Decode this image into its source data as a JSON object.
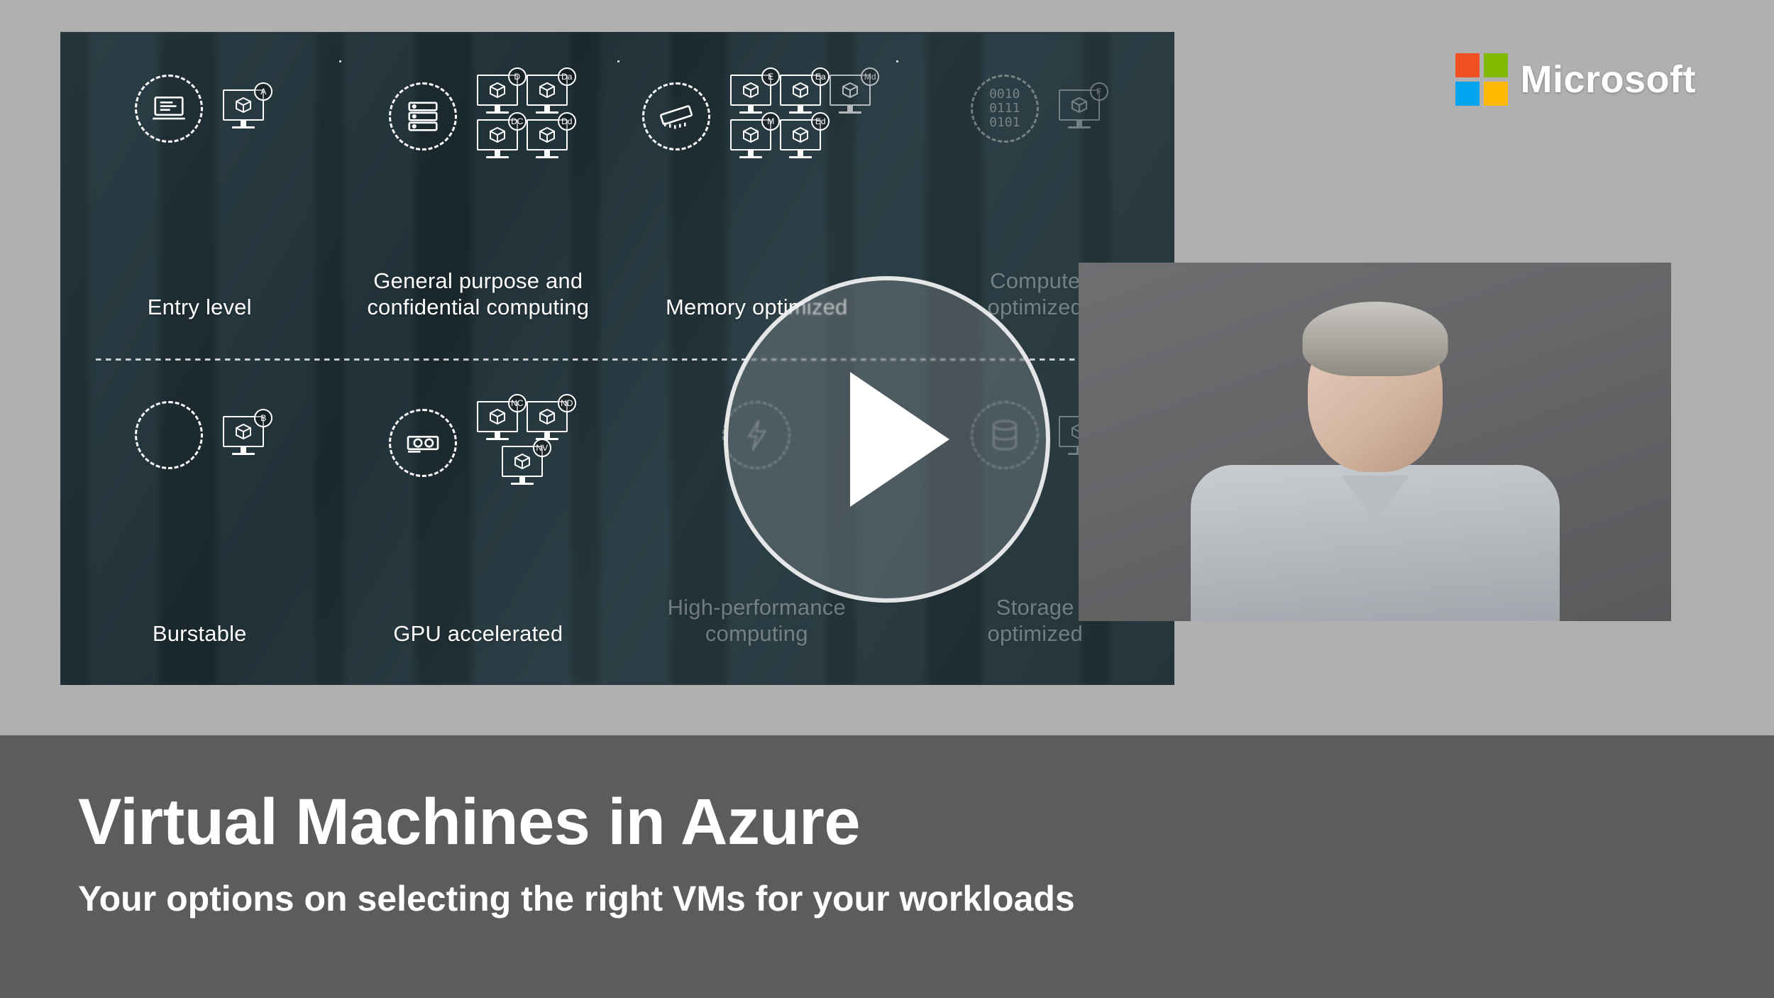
{
  "brand": {
    "name": "Microsoft"
  },
  "title": {
    "main": "Virtual Machines in Azure",
    "sub": "Your options on selecting the right VMs for your workloads"
  },
  "play_button_tooltip": "Play video",
  "vm_families": [
    {
      "id": "entry",
      "label": "Entry level",
      "badges": [
        "A"
      ]
    },
    {
      "id": "general",
      "label": "General purpose and\nconfidential computing",
      "badges": [
        "D",
        "Da",
        "DC",
        "Dd"
      ]
    },
    {
      "id": "memory",
      "label": "Memory optimized",
      "badges": [
        "E",
        "Ea",
        "M",
        "Ed",
        "Md"
      ]
    },
    {
      "id": "compute",
      "label": "Compute\noptimized",
      "badges": [
        "F"
      ]
    },
    {
      "id": "burst",
      "label": "Burstable",
      "badges": [
        "B"
      ]
    },
    {
      "id": "gpu",
      "label": "GPU accelerated",
      "badges": [
        "NC",
        "ND",
        "NV"
      ]
    },
    {
      "id": "hpc",
      "label": "High-performance\ncomputing",
      "badges": []
    },
    {
      "id": "storage",
      "label": "Storage\noptimized",
      "badges": []
    }
  ],
  "binary_text": "0010\n0111\n0101"
}
